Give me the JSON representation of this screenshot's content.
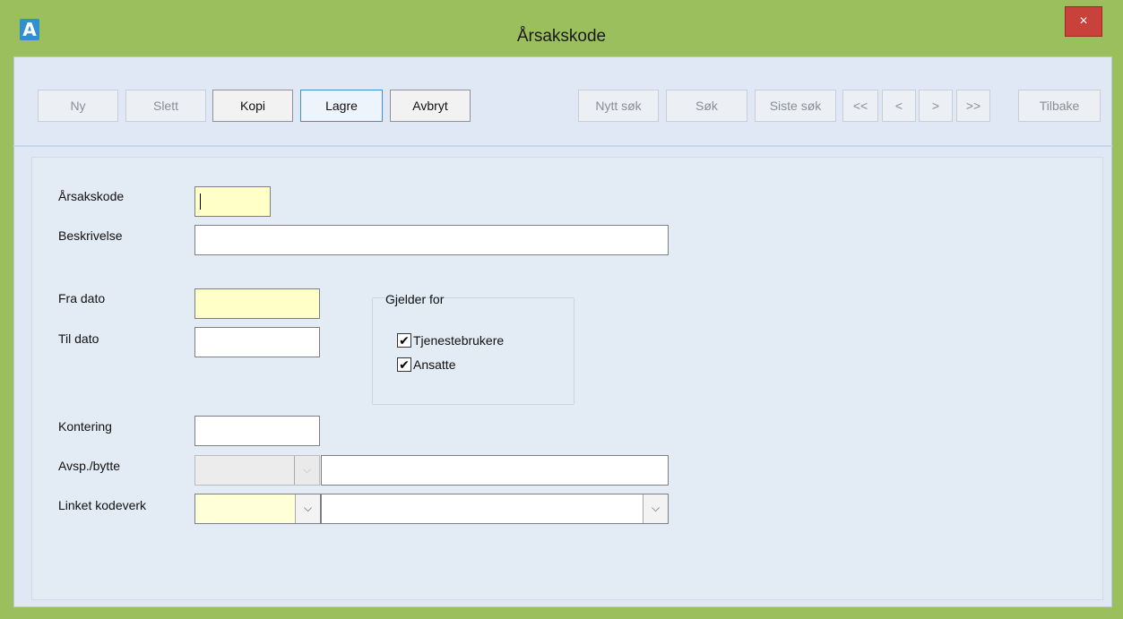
{
  "window": {
    "title": "Årsakskode",
    "app_icon": "A",
    "close_label": "×"
  },
  "toolbar": {
    "ny": "Ny",
    "slett": "Slett",
    "kopi": "Kopi",
    "lagre": "Lagre",
    "avbryt": "Avbryt",
    "nytt_sok": "Nytt søk",
    "sok": "Søk",
    "siste_sok": "Siste søk",
    "first": "<<",
    "prev": "<",
    "next": ">",
    "last": ">>",
    "tilbake": "Tilbake"
  },
  "form": {
    "arsakskode_label": "Årsakskode",
    "arsakskode_value": "",
    "beskrivelse_label": "Beskrivelse",
    "beskrivelse_value": "",
    "fra_dato_label": "Fra dato",
    "fra_dato_value": "",
    "til_dato_label": "Til dato",
    "til_dato_value": "",
    "kontering_label": "Kontering",
    "kontering_value": "",
    "avsp_label": "Avsp./bytte",
    "avsp_value": "",
    "linket_label": "Linket kodeverk",
    "linket_value": ""
  },
  "gjelder_for": {
    "title": "Gjelder for",
    "options": [
      {
        "label": "Tjenestebrukere",
        "checked": true
      },
      {
        "label": "Ansatte",
        "checked": true
      }
    ]
  },
  "icons": {
    "check": "✔",
    "chevron": "⌵"
  }
}
